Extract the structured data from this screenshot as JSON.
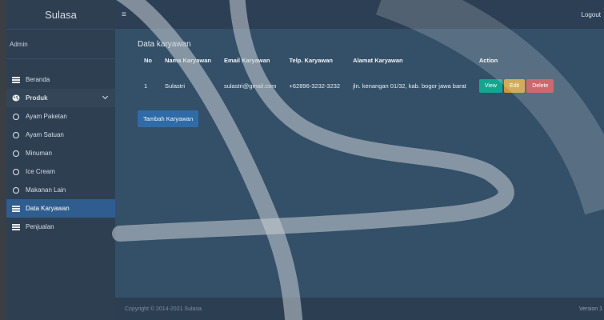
{
  "brand": "Sulasa",
  "user": "Admin",
  "topbar": {
    "logout": "Logout"
  },
  "sidebar": {
    "items": [
      {
        "label": "Beranda",
        "icon": "grid-icon"
      },
      {
        "label": "Produk",
        "icon": "palette-icon"
      },
      {
        "label": "Ayam Paketan",
        "icon": "circle-icon"
      },
      {
        "label": "Ayam Satuan",
        "icon": "circle-icon"
      },
      {
        "label": "Minuman",
        "icon": "circle-icon"
      },
      {
        "label": "Ice Cream",
        "icon": "circle-icon"
      },
      {
        "label": "Makanan Lain",
        "icon": "circle-icon"
      },
      {
        "label": "Data Karyawan",
        "icon": "table-icon"
      },
      {
        "label": "Penjualan",
        "icon": "grid-icon"
      }
    ]
  },
  "page": {
    "title": "Data karyawan",
    "headers": [
      "No",
      "Nama Karyawan",
      "Email Karyawan",
      "Telp. Karyawan",
      "Alamat Karyawan",
      "Action"
    ],
    "rows": [
      {
        "no": "1",
        "nama": "Sulastri",
        "email": "sulastri@gmail.com",
        "telp": "+62896-3232-3232",
        "alamat": "jln. kenangan 01/32, kab. bogor jawa barat"
      }
    ],
    "actions": {
      "view": "View",
      "edit": "Edit",
      "delete": "Delete"
    },
    "add_button": "Tambah Karyawan"
  },
  "footer": {
    "copyright": "Copyright © 2014-2021 Sulasa.",
    "version": "Version 1"
  },
  "colors": {
    "sidebar_bg": "#2e3f52",
    "main_bg": "#345068",
    "active_bg": "#2f5d8f",
    "view": "#14a58f",
    "edit": "#c99a38",
    "delete": "#c0494f"
  }
}
